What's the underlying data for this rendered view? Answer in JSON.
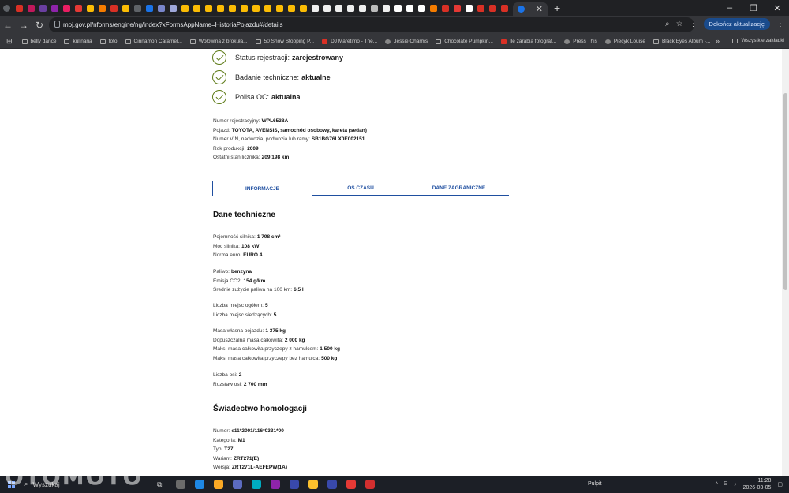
{
  "browser": {
    "tab_icon_colors": [
      "#d93025",
      "#c2185b",
      "#6a3fa0",
      "#8e24aa",
      "#e91e63",
      "#e53935",
      "#fbbc04",
      "#f57c00",
      "#d93025",
      "#fbbc04",
      "#5f6368",
      "#1a73e8",
      "#7986cb",
      "#9fa8da",
      "#fbbc04",
      "#fbbc04",
      "#fbbc04",
      "#fbbc04",
      "#fbbc04",
      "#fbbc04",
      "#fbbc04",
      "#fbbc04",
      "#fbbc04",
      "#fbbc04",
      "#fbbc04",
      "#eeeeee",
      "#eeeeee",
      "#eeeeee",
      "#eeeeee",
      "#eeeeee",
      "#bbbbbb",
      "#eeeeee",
      "#ffffff",
      "#ffffff",
      "#ffffff",
      "#f57c00",
      "#d93025",
      "#e53935",
      "#ffffff",
      "#d93025",
      "#d93025",
      "#d93025"
    ],
    "url": "moj.gov.pl/nforms/engine/ng/index?xFormsAppName=HistoriaPojazdu#/details",
    "update_button": "Dokończ aktualizację",
    "bookmarks": [
      {
        "label": "belly dance",
        "icon": "folder"
      },
      {
        "label": "kulinaria",
        "icon": "folder"
      },
      {
        "label": "foto",
        "icon": "folder"
      },
      {
        "label": "Cinnamon Caramel...",
        "icon": "folder"
      },
      {
        "label": "Wołowina z brokuła...",
        "icon": "page"
      },
      {
        "label": "50 Show Stopping P...",
        "icon": "page"
      },
      {
        "label": "DJ Maretimo - The...",
        "icon": "red"
      },
      {
        "label": "Jessie Charms",
        "icon": "round"
      },
      {
        "label": "Chocolate Pumpkin...",
        "icon": "page"
      },
      {
        "label": "Ile zarabia fotograf...",
        "icon": "red"
      },
      {
        "label": "Press This",
        "icon": "round"
      },
      {
        "label": "Piecyk Louise",
        "icon": "round"
      },
      {
        "label": "Black Eyes Album -...",
        "icon": "page"
      }
    ],
    "all_bookmarks": "Wszystkie zakładki"
  },
  "status": [
    {
      "label": "Status rejestracji:",
      "value": "zarejestrowany"
    },
    {
      "label": "Badanie techniczne:",
      "value": "aktualne"
    },
    {
      "label": "Polisa OC:",
      "value": "aktualna"
    }
  ],
  "vehicle": [
    {
      "label": "Numer rejestracyjny:",
      "value": "WPL6538A"
    },
    {
      "label": "Pojazd:",
      "value": "TOYOTA, AVENSIS, samochód osobowy, kareta (sedan)"
    },
    {
      "label": "Numer VIN, nadwozia, podwozia lub ramy:",
      "value": "SB1BG76LX0E002151"
    },
    {
      "label": "Rok produkcji:",
      "value": "2009"
    },
    {
      "label": "Ostatni stan licznika:",
      "value": "209 198 km"
    }
  ],
  "tabs": [
    "INFORMACJE",
    "OŚ CZASU",
    "DANE ZAGRANICZNE"
  ],
  "tech": {
    "title": "Dane techniczne",
    "groups": [
      [
        {
          "label": "Pojemność silnika:",
          "value": "1 798 cm³"
        },
        {
          "label": "Moc silnika:",
          "value": "108 kW"
        },
        {
          "label": "Norma euro:",
          "value": "EURO 4"
        }
      ],
      [
        {
          "label": "Paliwo:",
          "value": "benzyna"
        },
        {
          "label": "Emisja CO2:",
          "value": "154 g/km"
        },
        {
          "label": "Średnie zużycie paliwa na 100 km:",
          "value": "6,5 l"
        }
      ],
      [
        {
          "label": "Liczba miejsc ogółem:",
          "value": "5"
        },
        {
          "label": "Liczba miejsc siedzących:",
          "value": "5"
        }
      ],
      [
        {
          "label": "Masa własna pojazdu:",
          "value": "1 375 kg"
        },
        {
          "label": "Dopuszczalna masa całkowita:",
          "value": "2 000 kg"
        },
        {
          "label": "Maks. masa całkowita przyczepy z hamulcem:",
          "value": "1 500 kg"
        },
        {
          "label": "Maks. masa całkowita przyczepy bez hamulca:",
          "value": "500 kg"
        }
      ],
      [
        {
          "label": "Liczba osi:",
          "value": "2"
        },
        {
          "label": "Rozstaw osi:",
          "value": "2 700 mm"
        }
      ]
    ]
  },
  "homologation": {
    "title": "Świadectwo homologacji",
    "rows": [
      {
        "label": "Numer:",
        "value": "e11*2001/116*0331*00"
      },
      {
        "label": "Kategoria:",
        "value": "M1"
      },
      {
        "label": "Typ:",
        "value": "T27"
      },
      {
        "label": "Wariant:",
        "value": "ZRT271(E)"
      },
      {
        "label": "Wersja:",
        "value": "ZRT271L-AEFEPW(1A)"
      }
    ]
  },
  "taskbar": {
    "search_label": "Wyszukaj",
    "watermark": "OTOMOTO",
    "pulpit": "Pulpit",
    "time": "11:28",
    "date": "2026-03-05",
    "app_colors": [
      "#6b6b6b",
      "#1e88e5",
      "#f9a825",
      "#5c6bc0",
      "#00acc1",
      "#8e24aa",
      "#3949ab",
      "#fbc02d",
      "#3949ab",
      "#e53935",
      "#d32f2f"
    ]
  }
}
